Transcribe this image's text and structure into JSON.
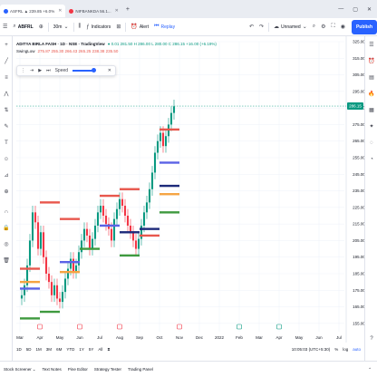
{
  "tabs": [
    {
      "label": "ASFRL ▲ 239.85 +6.0%",
      "active": true
    },
    {
      "label": "NIFBANKDA 56.1...",
      "active": false
    }
  ],
  "toolbar": {
    "symbol": "ABFRL",
    "interval": "30m",
    "indicators": "Indicators",
    "alert": "Alert",
    "replay": "Replay",
    "layout": "Unnamed",
    "publish": "Publish"
  },
  "legend": {
    "title": "ADITYA BIRLA FASH · 1D · NSE · TradingView",
    "ohlc": "● 0.01 281.50 H 286.00 L 280.00 C 286.15 +16.00 (+6.19%)",
    "indicator_label": "SwingLow",
    "indicator_values": "275.87  255.30  266.43  265.25  238.38  235.50"
  },
  "replay_panel": {
    "speed_label": "Speed"
  },
  "price_badge": "286.15",
  "colors": {
    "up": "#089981",
    "down": "#f23645",
    "red_level": "#e8574d",
    "blue_level": "#5b63e6",
    "navy_level": "#1d2a7a",
    "green_level": "#3f9a3f",
    "orange_level": "#f5a442",
    "badge": "#089981"
  },
  "chart_data": {
    "type": "candlestick",
    "ylim": [
      150,
      325
    ],
    "y_ticks": [
      325,
      315,
      305,
      295,
      285,
      275,
      265,
      255,
      245,
      235,
      225,
      215,
      205,
      195,
      185,
      175,
      165,
      155
    ],
    "x_tick_labels": [
      "Mar",
      "Apr",
      "May",
      "Jun",
      "Jul",
      "Aug",
      "Sep",
      "Oct",
      "Nov",
      "Dec",
      "2022",
      "Feb",
      "Mar",
      "Apr",
      "May",
      "Jun",
      "Jul"
    ],
    "x_start": "2021-03",
    "x_end": "2022-07",
    "series": [
      {
        "name": "ABFRL",
        "values": [
          172,
          178,
          190,
          205,
          222,
          216,
          200,
          210,
          195,
          185,
          180,
          172,
          178,
          170,
          168,
          174,
          182,
          188,
          194,
          186,
          190,
          198,
          205,
          212,
          208,
          200,
          206,
          214,
          222,
          226,
          220,
          215,
          212,
          205,
          218,
          224,
          230,
          226,
          220,
          214,
          210,
          205,
          200,
          206,
          214,
          222,
          228,
          236,
          246,
          258,
          265,
          270,
          262,
          268,
          275,
          282,
          286
        ]
      }
    ],
    "levels": [
      {
        "color": "red",
        "from": "Mar",
        "to": "Apr",
        "value": 188
      },
      {
        "color": "red",
        "from": "Apr",
        "to": "May",
        "value": 228
      },
      {
        "color": "red",
        "from": "May",
        "to": "Jun",
        "value": 218
      },
      {
        "color": "red",
        "from": "Jul",
        "to": "Aug",
        "value": 232
      },
      {
        "color": "red",
        "from": "Aug",
        "to": "Sep",
        "value": 236
      },
      {
        "color": "red",
        "from": "Oct",
        "to": "Nov",
        "value": 272
      },
      {
        "color": "red",
        "from": "Sep",
        "to": "Oct",
        "value": 208
      },
      {
        "color": "blue",
        "from": "Mar",
        "to": "Apr",
        "value": 176
      },
      {
        "color": "blue",
        "from": "May",
        "to": "Jun",
        "value": 192
      },
      {
        "color": "blue",
        "from": "Jul",
        "to": "Aug",
        "value": 214
      },
      {
        "color": "blue",
        "from": "Oct",
        "to": "Nov",
        "value": 252
      },
      {
        "color": "navy",
        "from": "Aug",
        "to": "Sep",
        "value": 210
      },
      {
        "color": "navy",
        "from": "Sep",
        "to": "Oct",
        "value": 212
      },
      {
        "color": "navy",
        "from": "Oct",
        "to": "Nov",
        "value": 238
      },
      {
        "color": "orange",
        "from": "Oct",
        "to": "Nov",
        "value": 233
      },
      {
        "color": "orange",
        "from": "Mar",
        "to": "Apr",
        "value": 180
      },
      {
        "color": "orange",
        "from": "May",
        "to": "Jun",
        "value": 186
      },
      {
        "color": "green",
        "from": "Mar",
        "to": "Apr",
        "value": 158
      },
      {
        "color": "green",
        "from": "Apr",
        "to": "May",
        "value": 162
      },
      {
        "color": "green",
        "from": "Jun",
        "to": "Jul",
        "value": 200
      },
      {
        "color": "green",
        "from": "Aug",
        "to": "Sep",
        "value": 196
      },
      {
        "color": "green",
        "from": "Oct",
        "to": "Nov",
        "value": 222
      }
    ]
  },
  "bottom_info": {
    "ranges": [
      "1D",
      "5D",
      "1M",
      "3M",
      "6M",
      "YTD",
      "1Y",
      "5Y",
      "All"
    ],
    "time": "10:05:03 (UTC+5:30)",
    "pct": "%",
    "log": "log",
    "auto": "auto"
  },
  "bottom_tabs": [
    "Stock Screener",
    "Text Notes",
    "Pine Editor",
    "Strategy Tester",
    "Trading Panel"
  ]
}
